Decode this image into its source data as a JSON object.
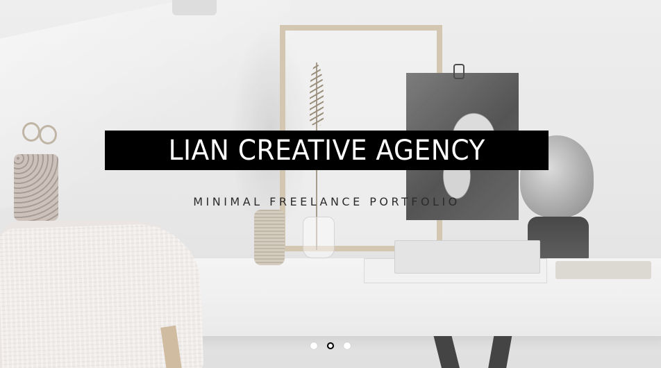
{
  "hero": {
    "title": "LIAN CREATIVE AGENCY",
    "subtitle": "MINIMAL FREELANCE PORTFOLIO",
    "title_band_color": "#000000",
    "title_text_color": "#ffffff"
  },
  "slider": {
    "dot_count": 3,
    "active_index": 1
  }
}
